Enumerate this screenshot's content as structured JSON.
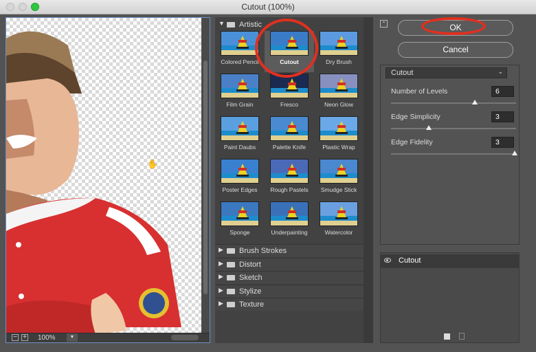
{
  "window": {
    "title": "Cutout (100%)"
  },
  "preview": {
    "zoom": "100%",
    "zoom_out": "−",
    "zoom_in": "+",
    "hand": "✋"
  },
  "gallery": {
    "expanded_category": "Artistic",
    "filters": [
      {
        "label": "Colored Pencil"
      },
      {
        "label": "Cutout"
      },
      {
        "label": "Dry Brush"
      },
      {
        "label": "Film Grain"
      },
      {
        "label": "Fresco"
      },
      {
        "label": "Neon Glow"
      },
      {
        "label": "Paint Daubs"
      },
      {
        "label": "Palette Knife"
      },
      {
        "label": "Plastic Wrap"
      },
      {
        "label": "Poster Edges"
      },
      {
        "label": "Rough Pastels"
      },
      {
        "label": "Smudge Stick"
      },
      {
        "label": "Sponge"
      },
      {
        "label": "Underpainting"
      },
      {
        "label": "Watercolor"
      }
    ],
    "selected_filter": "Cutout",
    "categories": [
      "Brush Strokes",
      "Distort",
      "Sketch",
      "Stylize",
      "Texture"
    ]
  },
  "buttons": {
    "ok": "OK",
    "cancel": "Cancel"
  },
  "settings": {
    "filter": "Cutout",
    "params": [
      {
        "label": "Number of Levels",
        "value": "6",
        "fraction": 0.67
      },
      {
        "label": "Edge Simplicity",
        "value": "3",
        "fraction": 0.3
      },
      {
        "label": "Edge Fidelity",
        "value": "3",
        "fraction": 0.99
      }
    ]
  },
  "layers": {
    "items": [
      {
        "name": "Cutout"
      }
    ]
  },
  "colors": {
    "highlight_ring": "#e03020",
    "preview_border": "#6d8fc7"
  }
}
